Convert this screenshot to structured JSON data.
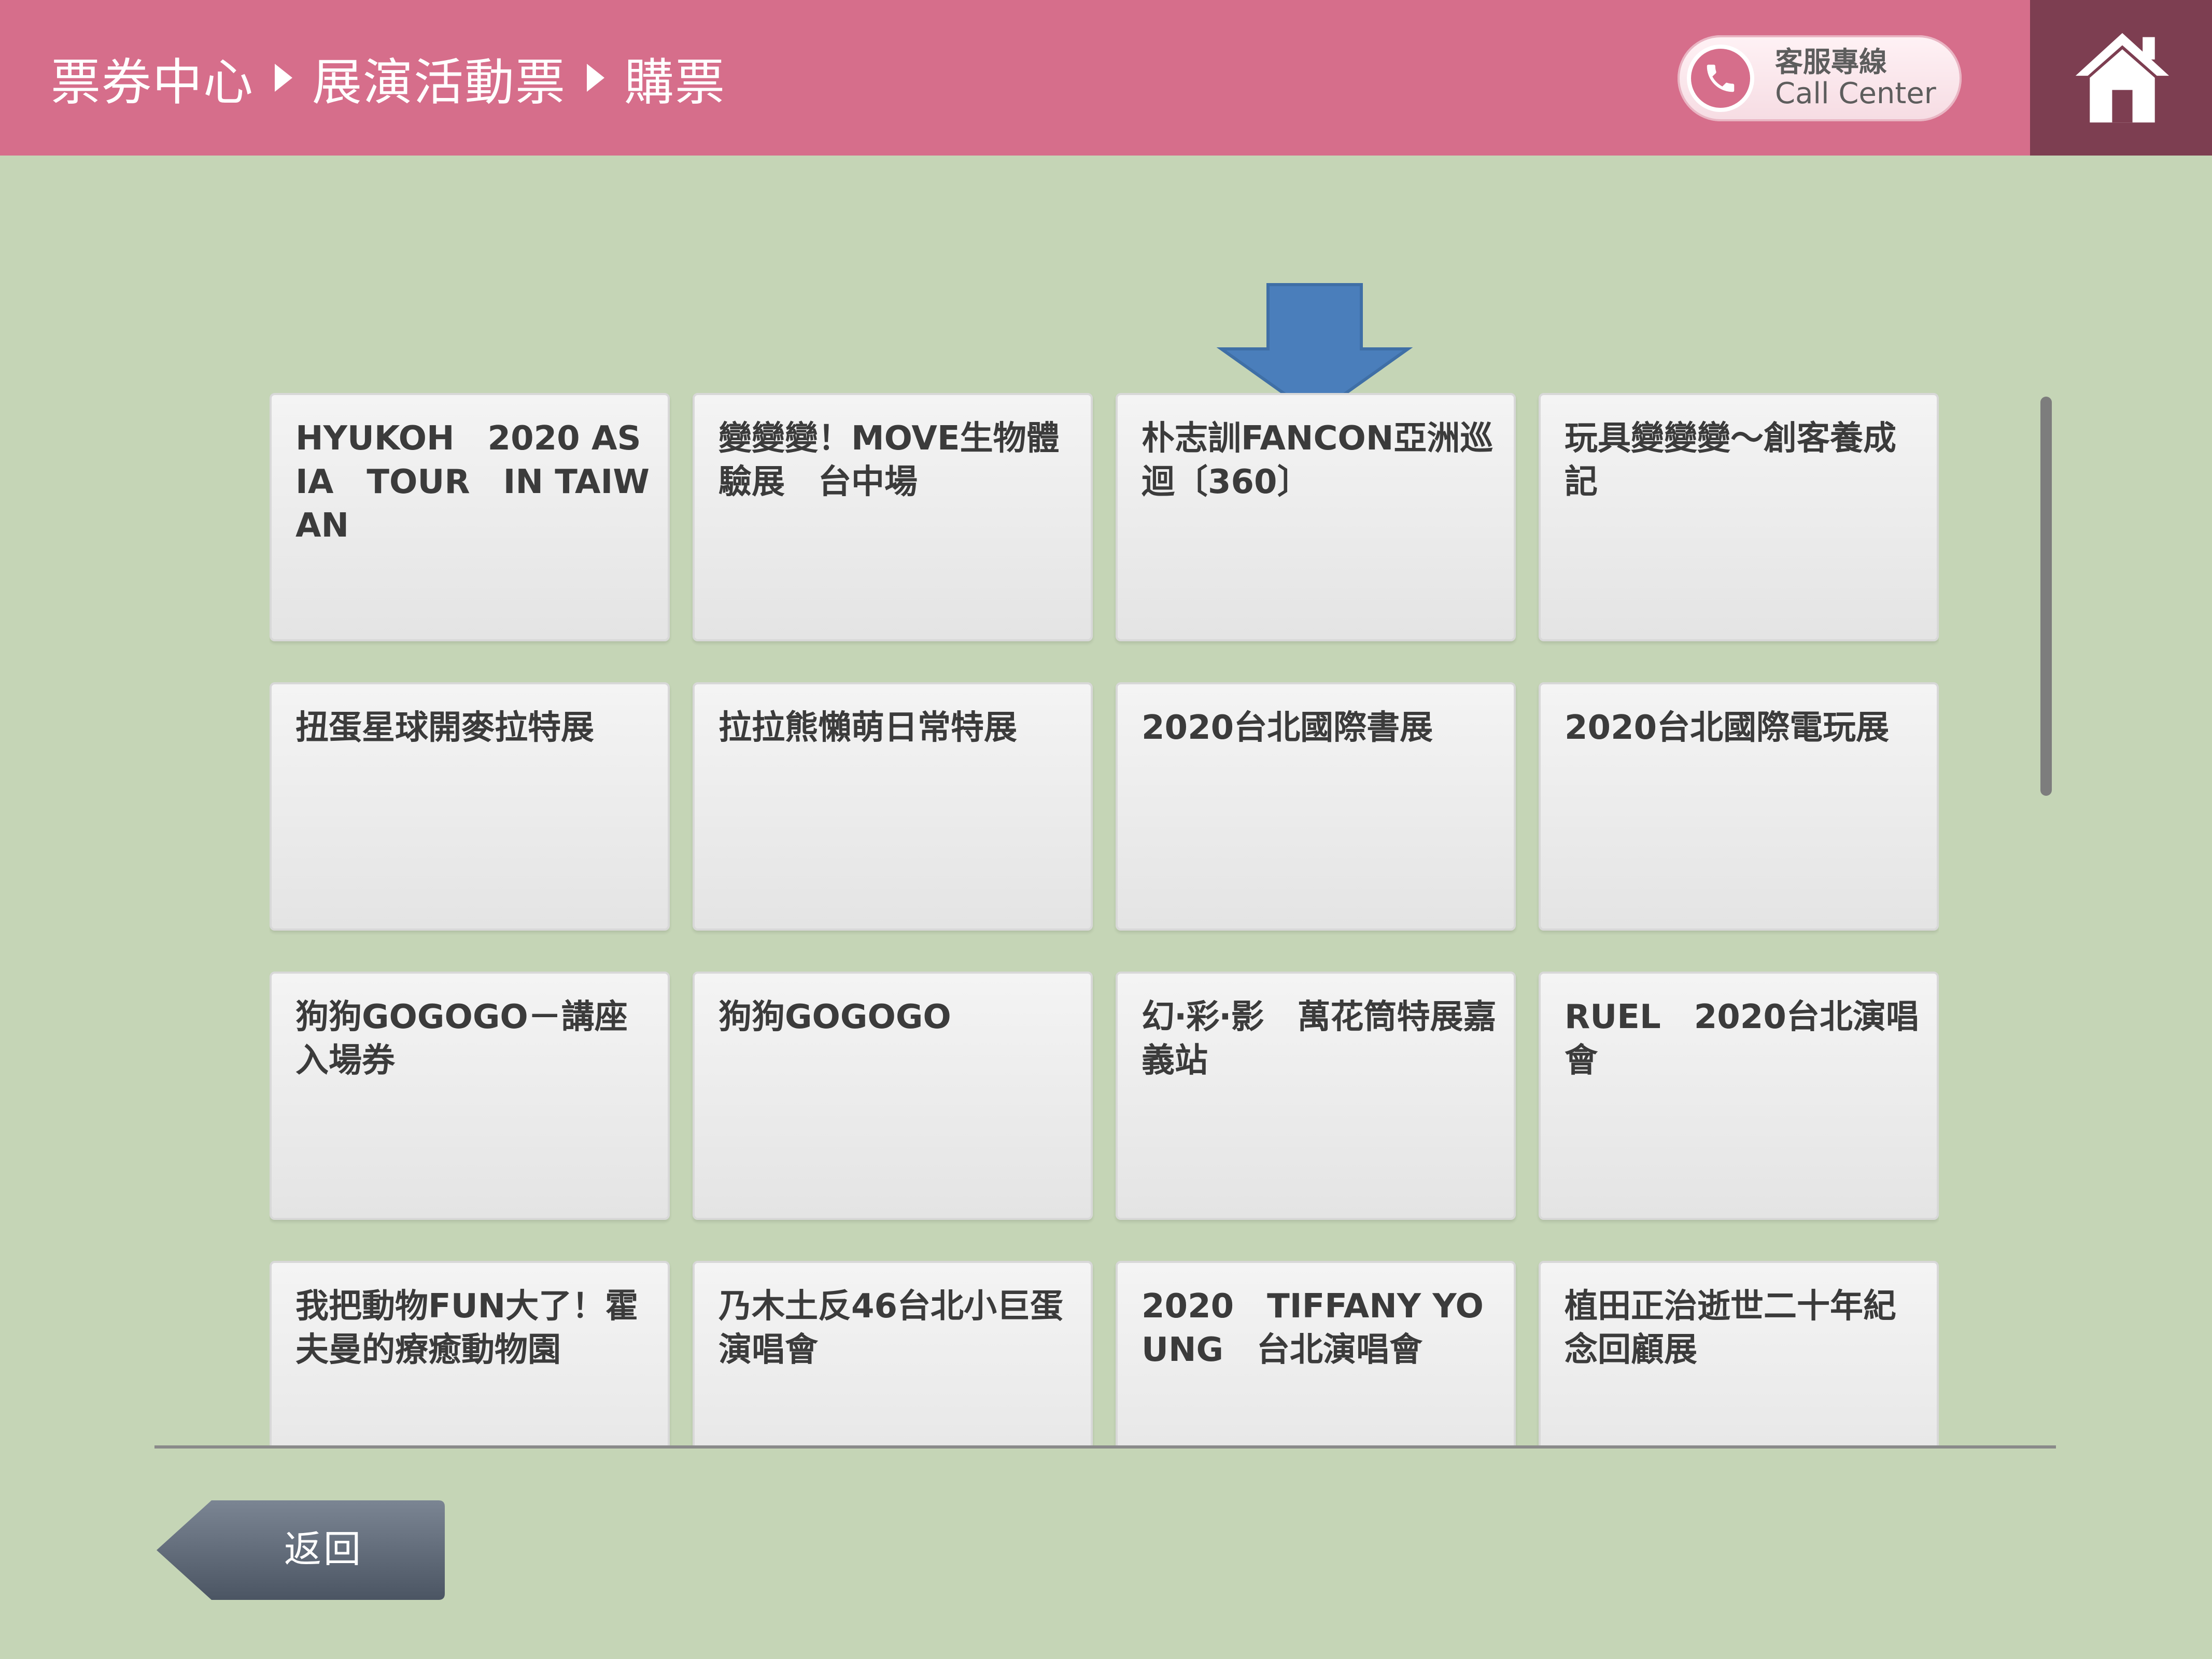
{
  "header": {
    "breadcrumb": [
      "票券中心",
      "展演活動票",
      "購票"
    ],
    "call_center": {
      "line1": "客服專線",
      "line2": "Call Center"
    }
  },
  "icons": {
    "phone": "phone-icon",
    "home": "home-icon",
    "arrow": "down-arrow-indicator",
    "back": "back-arrow-icon"
  },
  "colors": {
    "header_bg": "#d66e8b",
    "home_bg": "#7d3e51",
    "page_bg": "#c5d5b6",
    "arrow": "#4a7ebb",
    "back_button": "#5a6573"
  },
  "events": [
    "HYUKOH　2020 ASIA　TOUR　IN TAIWAN",
    "變變變！MOVE生物體驗展　台中場",
    "朴志訓FANCON亞洲巡迴〔360〕",
    "玩具變變變～創客養成記",
    "扭蛋星球開麥拉特展",
    "拉拉熊懶萌日常特展",
    "2020台北國際書展",
    "2020台北國際電玩展",
    "狗狗GOGOGO－講座入場券",
    "狗狗GOGOGO",
    "幻‧彩‧影　萬花筒特展嘉義站",
    "RUEL　2020台北演唱會",
    "我把動物FUN大了！霍夫曼的療癒動物園",
    "乃木土反46台北小巨蛋演唱會",
    "2020　TIFFANY YOUNG　台北演唱會",
    "植田正治逝世二十年紀念回顧展"
  ],
  "footer": {
    "back_label": "返回"
  }
}
